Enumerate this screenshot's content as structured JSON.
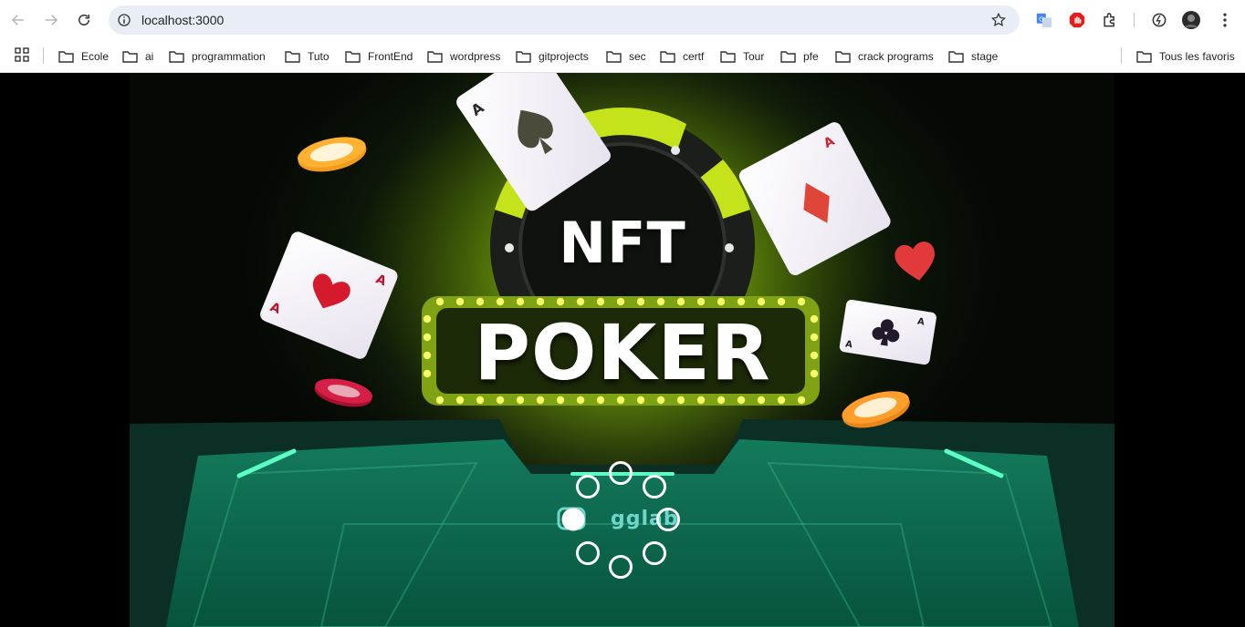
{
  "browser": {
    "url": "localhost:3000",
    "icons": [
      "back-icon",
      "forward-icon",
      "reload-icon",
      "site-info-icon",
      "bookmark-star-icon",
      "google-translate-icon",
      "adblock-icon",
      "extensions-icon",
      "performance-icon",
      "profile-avatar",
      "menu-icon"
    ]
  },
  "bookmarks": {
    "items": [
      "Ecole",
      "ai",
      "programmation",
      "Tuto",
      "FrontEnd",
      "wordpress",
      "gitprojects",
      "sec",
      "certf",
      "Tour",
      "pfe",
      "crack programs",
      "stage"
    ],
    "all_bookmarks": "Tous les favoris"
  },
  "page": {
    "hero_title_top": "NFT",
    "hero_title_main": "POKER",
    "brand": "gglab",
    "accent_color": "#c6e21a",
    "table_color": "#0f6b52"
  }
}
